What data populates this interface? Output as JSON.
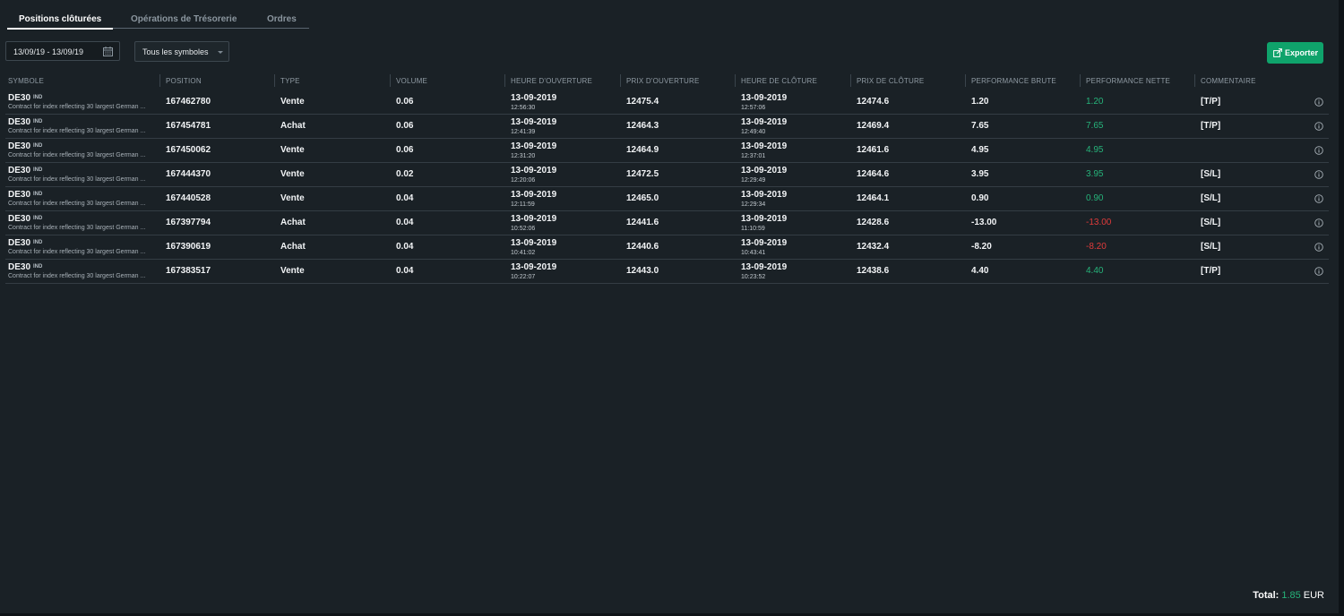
{
  "tabs": [
    {
      "label": "Positions clôturées",
      "active": true
    },
    {
      "label": "Opérations de Trésorerie",
      "active": false
    },
    {
      "label": "Ordres",
      "active": false
    }
  ],
  "filters": {
    "date_range": "13/09/19 - 13/09/19",
    "date_icon": "calendar-icon",
    "symbol_select": "Tous les symboles"
  },
  "export": {
    "label": "Exporter",
    "icon": "export-icon"
  },
  "columns": {
    "symbol": "SYMBOLE",
    "position": "POSITION",
    "type": "TYPE",
    "volume": "VOLUME",
    "open_time": "HEURE D'OUVERTURE",
    "open_price": "PRIX D'OUVERTURE",
    "close_time": "HEURE DE CLÔTURE",
    "close_price": "PRIX DE CLÔTURE",
    "gross": "PERFORMANCE BRUTE",
    "net": "PERFORMANCE NETTE",
    "comment": "COMMENTAIRE"
  },
  "rows": [
    {
      "symbol": "DE30",
      "tag": "IND",
      "desc": "Contract for index reflecting 30 largest German ...",
      "position": "167462780",
      "type": "Vente",
      "volume": "0.06",
      "open_date": "13-09-2019",
      "open_time": "12:56:30",
      "open_price": "12475.4",
      "close_date": "13-09-2019",
      "close_time": "12:57:06",
      "close_price": "12474.6",
      "gross": "1.20",
      "net": "1.20",
      "net_sign": "pos",
      "comment": "[T/P]"
    },
    {
      "symbol": "DE30",
      "tag": "IND",
      "desc": "Contract for index reflecting 30 largest German ...",
      "position": "167454781",
      "type": "Achat",
      "volume": "0.06",
      "open_date": "13-09-2019",
      "open_time": "12:41:39",
      "open_price": "12464.3",
      "close_date": "13-09-2019",
      "close_time": "12:49:40",
      "close_price": "12469.4",
      "gross": "7.65",
      "net": "7.65",
      "net_sign": "pos",
      "comment": "[T/P]"
    },
    {
      "symbol": "DE30",
      "tag": "IND",
      "desc": "Contract for index reflecting 30 largest German ...",
      "position": "167450062",
      "type": "Vente",
      "volume": "0.06",
      "open_date": "13-09-2019",
      "open_time": "12:31:20",
      "open_price": "12464.9",
      "close_date": "13-09-2019",
      "close_time": "12:37:01",
      "close_price": "12461.6",
      "gross": "4.95",
      "net": "4.95",
      "net_sign": "pos",
      "comment": ""
    },
    {
      "symbol": "DE30",
      "tag": "IND",
      "desc": "Contract for index reflecting 30 largest German ...",
      "position": "167444370",
      "type": "Vente",
      "volume": "0.02",
      "open_date": "13-09-2019",
      "open_time": "12:20:06",
      "open_price": "12472.5",
      "close_date": "13-09-2019",
      "close_time": "12:29:49",
      "close_price": "12464.6",
      "gross": "3.95",
      "net": "3.95",
      "net_sign": "pos",
      "comment": "[S/L]"
    },
    {
      "symbol": "DE30",
      "tag": "IND",
      "desc": "Contract for index reflecting 30 largest German ...",
      "position": "167440528",
      "type": "Vente",
      "volume": "0.04",
      "open_date": "13-09-2019",
      "open_time": "12:11:59",
      "open_price": "12465.0",
      "close_date": "13-09-2019",
      "close_time": "12:29:34",
      "close_price": "12464.1",
      "gross": "0.90",
      "net": "0.90",
      "net_sign": "pos",
      "comment": "[S/L]"
    },
    {
      "symbol": "DE30",
      "tag": "IND",
      "desc": "Contract for index reflecting 30 largest German ...",
      "position": "167397794",
      "type": "Achat",
      "volume": "0.04",
      "open_date": "13-09-2019",
      "open_time": "10:52:06",
      "open_price": "12441.6",
      "close_date": "13-09-2019",
      "close_time": "11:10:59",
      "close_price": "12428.6",
      "gross": "-13.00",
      "net": "-13.00",
      "net_sign": "neg",
      "comment": "[S/L]"
    },
    {
      "symbol": "DE30",
      "tag": "IND",
      "desc": "Contract for index reflecting 30 largest German ...",
      "position": "167390619",
      "type": "Achat",
      "volume": "0.04",
      "open_date": "13-09-2019",
      "open_time": "10:41:02",
      "open_price": "12440.6",
      "close_date": "13-09-2019",
      "close_time": "10:43:41",
      "close_price": "12432.4",
      "gross": "-8.20",
      "net": "-8.20",
      "net_sign": "neg",
      "comment": "[S/L]"
    },
    {
      "symbol": "DE30",
      "tag": "IND",
      "desc": "Contract for index reflecting 30 largest German ...",
      "position": "167383517",
      "type": "Vente",
      "volume": "0.04",
      "open_date": "13-09-2019",
      "open_time": "10:22:07",
      "open_price": "12443.0",
      "close_date": "13-09-2019",
      "close_time": "10:23:52",
      "close_price": "12438.6",
      "gross": "4.40",
      "net": "4.40",
      "net_sign": "pos",
      "comment": "[T/P]"
    }
  ],
  "row_icon": "info-icon",
  "total": {
    "label": "Total:",
    "value": "1.85",
    "currency": "EUR"
  },
  "colors": {
    "background": "#1a2126",
    "accent_green": "#0fa36b",
    "positive": "#26b37a",
    "negative": "#e03b3b"
  }
}
